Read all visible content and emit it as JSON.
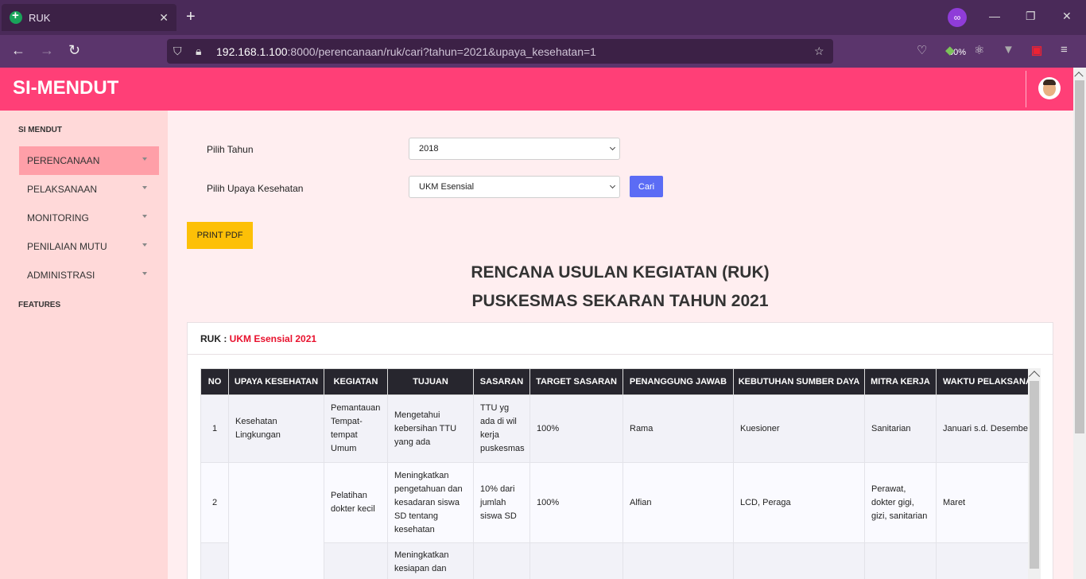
{
  "browser": {
    "tab_title": "RUK",
    "url_host": "192.168.1.100",
    "url_rest": ":8000/perencanaan/ruk/cari?tahun=2021&upaya_kesehatan=1",
    "zoom": "80%"
  },
  "app": {
    "brand": "SI-MENDUT"
  },
  "sidebar": {
    "section_main": "SI MENDUT",
    "items": [
      {
        "label": "PERENCANAAN"
      },
      {
        "label": "PELAKSANAAN"
      },
      {
        "label": "MONITORING"
      },
      {
        "label": "PENILAIAN MUTU"
      },
      {
        "label": "ADMINISTRASI"
      }
    ],
    "section_features": "FEATURES"
  },
  "form": {
    "tahun_label": "Pilih Tahun",
    "tahun_value": "2018",
    "upaya_label": "Pilih Upaya Kesehatan",
    "upaya_value": "UKM Esensial",
    "cari_label": "Cari",
    "print_label": "PRINT PDF"
  },
  "doc": {
    "title_line1": "RENCANA USULAN KEGIATAN (RUK)",
    "title_line2": "PUSKESMAS SEKARAN TAHUN 2021"
  },
  "card": {
    "ruk_prefix": "RUK :",
    "ruk_value": "UKM Esensial 2021"
  },
  "table": {
    "headers": [
      "NO",
      "UPAYA KESEHATAN",
      "KEGIATAN",
      "TUJUAN",
      "SASARAN",
      "TARGET SASARAN",
      "PENANGGUNG JAWAB",
      "KEBUTUHAN SUMBER DAYA",
      "MITRA KERJA",
      "WAKTU PELAKSANAAN"
    ],
    "rows": [
      {
        "no": "1",
        "upaya": "Kesehatan Lingkungan",
        "kegiatan": "Pemantauan Tempat-tempat Umum",
        "tujuan": "Mengetahui kebersihan TTU yang ada",
        "sasaran": "TTU yg ada di wil kerja puskesmas",
        "target": "100%",
        "pj": "Rama",
        "sumber": "Kuesioner",
        "mitra": "Sanitarian",
        "waktu": "Januari s.d. Desember"
      },
      {
        "no": "2",
        "upaya": "",
        "kegiatan": "Pelatihan dokter kecil",
        "tujuan": "Meningkatkan pengetahuan dan kesadaran siswa SD tentang kesehatan",
        "sasaran": "10% dari jumlah siswa SD",
        "target": "100%",
        "pj": "Alfian",
        "sumber": "LCD, Peraga",
        "mitra": "Perawat, dokter gigi, gizi, sanitarian",
        "waktu": "Maret"
      },
      {
        "no": "",
        "upaya": "",
        "kegiatan": "",
        "tujuan": "Meningkatkan kesiapan dan",
        "sasaran": "",
        "target": "",
        "pj": "",
        "sumber": "",
        "mitra": "",
        "waktu": ""
      }
    ]
  }
}
